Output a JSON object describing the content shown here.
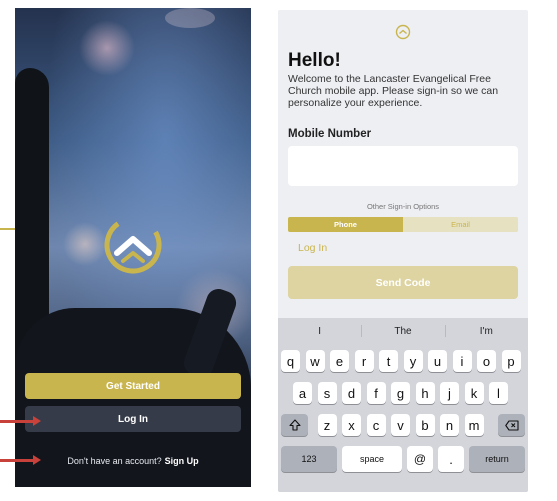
{
  "left_screen": {
    "get_started": "Get Started",
    "log_in": "Log In",
    "no_account": "Don't have an account?",
    "sign_up": "Sign Up"
  },
  "right_screen": {
    "title": "Hello!",
    "welcome": "Welcome to the Lancaster Evangelical Free Church mobile app. Please sign-in so we can personalize your experience.",
    "mobile_label": "Mobile Number",
    "mobile_value": "",
    "other_options": "Other Sign-in Options",
    "tabs": [
      "Phone",
      "Email"
    ],
    "log_in": "Log In",
    "send_code": "Send Code"
  },
  "keyboard": {
    "suggestions": [
      "I",
      "The",
      "I'm"
    ],
    "row1": [
      "q",
      "w",
      "e",
      "r",
      "t",
      "y",
      "u",
      "i",
      "o",
      "p"
    ],
    "row2": [
      "a",
      "s",
      "d",
      "f",
      "g",
      "h",
      "j",
      "k",
      "l"
    ],
    "row3": [
      "z",
      "x",
      "c",
      "v",
      "b",
      "n",
      "m"
    ],
    "numbers_key": "123",
    "space_key": "space",
    "at_key": "@",
    "dot_key": ".",
    "return_key": "return",
    "shift_icon": "shift-icon",
    "delete_icon": "delete-icon"
  },
  "colors": {
    "brand_gold": "#c9b54e",
    "brand_gold_light": "#ddd4a2",
    "annotation_arrow": "#c8413a"
  }
}
